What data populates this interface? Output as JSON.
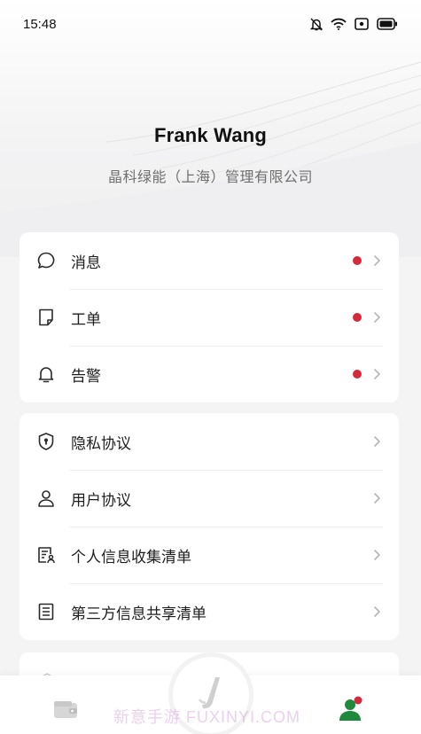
{
  "status_bar": {
    "time": "15:48",
    "icons": [
      "bell-muted-icon",
      "wifi-icon",
      "screen-record-icon",
      "battery-icon"
    ]
  },
  "profile": {
    "name": "Frank Wang",
    "company": "晶科绿能（上海）管理有限公司"
  },
  "notifications_card": {
    "items": [
      {
        "label": "消息",
        "icon": "message-icon",
        "unread": true
      },
      {
        "label": "工单",
        "icon": "work-order-icon",
        "unread": true
      },
      {
        "label": "告警",
        "icon": "alarm-bell-icon",
        "unread": true
      }
    ]
  },
  "agreements_card": {
    "items": [
      {
        "label": "隐私协议",
        "icon": "privacy-shield-icon"
      },
      {
        "label": "用户协议",
        "icon": "user-icon"
      },
      {
        "label": "个人信息收集清单",
        "icon": "personal-info-list-icon"
      },
      {
        "label": "第三方信息共享清单",
        "icon": "third-party-list-icon"
      }
    ]
  },
  "bottom_nav": {
    "items": [
      {
        "name": "wallet",
        "icon": "wallet-icon"
      },
      {
        "name": "home",
        "icon": "brand-logo-icon"
      },
      {
        "name": "profile",
        "icon": "profile-icon",
        "active": true
      }
    ]
  },
  "colors": {
    "badge": "#d42a3a",
    "active_nav": "#1f8a3c",
    "background": "#f4f4f5"
  },
  "watermark": "新意手游 FUXINYI.COM"
}
